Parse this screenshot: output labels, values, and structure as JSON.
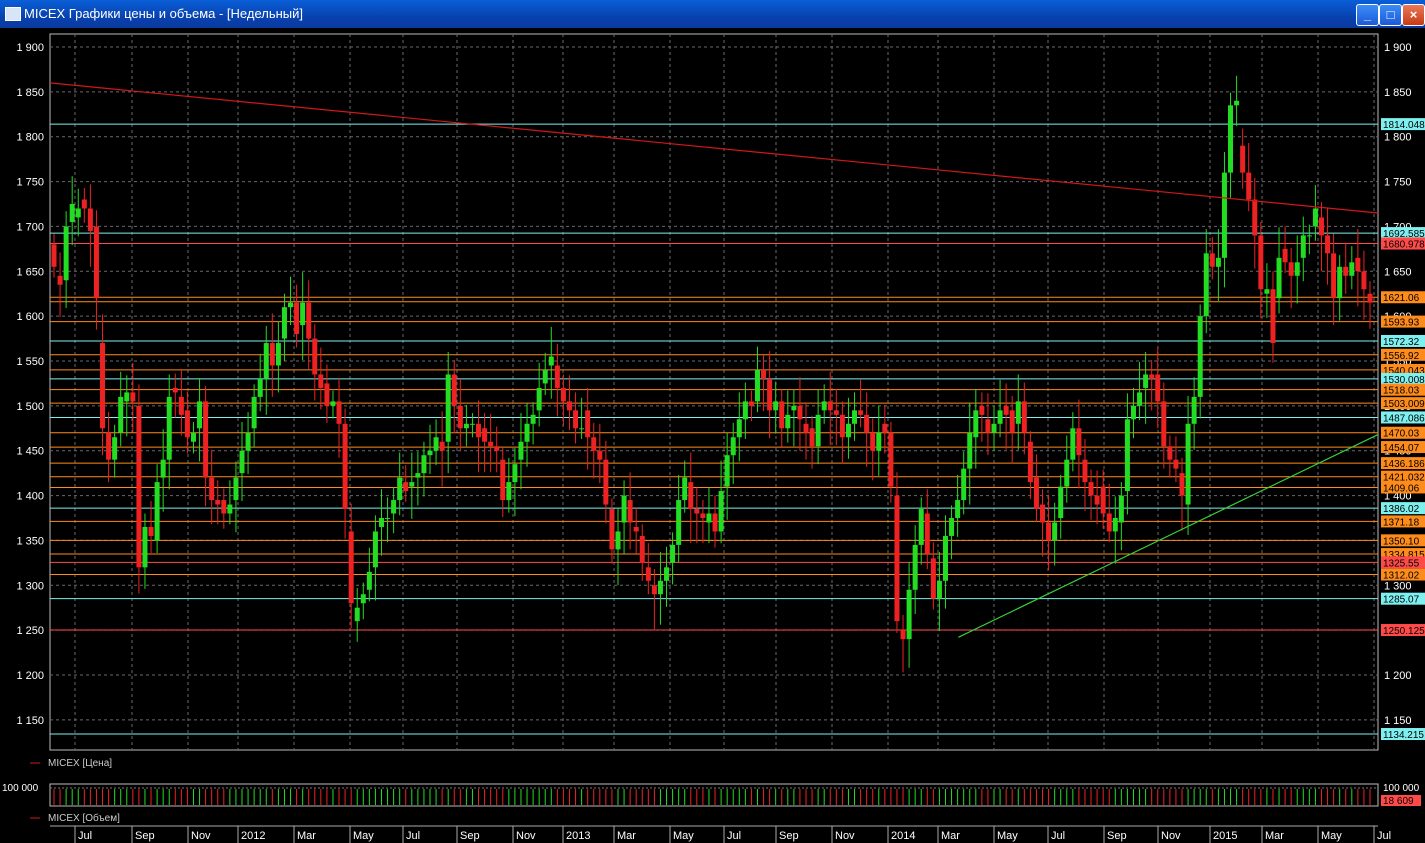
{
  "window": {
    "title": "MICEX Графики цены и объема - [Недельный]",
    "buttons": [
      "_",
      "□",
      "×"
    ]
  },
  "price_panel": {
    "legend": "MICEX [Цена]"
  },
  "volume_panel": {
    "legend": "MICEX [Объем]",
    "left_label": "100 000",
    "right_label": "100 000",
    "last_value": "18 609"
  },
  "colors": {
    "up": "#22dd22",
    "down": "#ee2222",
    "grid": "#6a6a6a",
    "cyan": "#7ff0f0",
    "red": "#ff4a4a",
    "orange": "#ff8c1a",
    "trend_down": "#d01818",
    "trend_up": "#3ad03a"
  },
  "chart_data": {
    "type": "candlestick",
    "title": "MICEX",
    "timeframe": "Недельный",
    "ylim": [
      1130,
      1920
    ],
    "y_ticks": [
      "1 150",
      "1 200",
      "1 250",
      "1 300",
      "1 350",
      "1 400",
      "1 450",
      "1 500",
      "1 550",
      "1 600",
      "1 650",
      "1 700",
      "1 750",
      "1 800",
      "1 850",
      "1 900"
    ],
    "x_labels": [
      "Jul",
      "Sep",
      "Nov",
      "2012",
      "Mar",
      "May",
      "Jul",
      "Sep",
      "Nov",
      "2013",
      "Mar",
      "May",
      "Jul",
      "Sep",
      "Nov",
      "2014",
      "Mar",
      "May",
      "Jul",
      "Sep",
      "Nov",
      "2015",
      "Mar",
      "May",
      "Jul"
    ],
    "candles": [
      [
        1680,
        1655
      ],
      [
        1645,
        1635
      ],
      [
        1640,
        1700
      ],
      [
        1705,
        1725
      ],
      [
        1710,
        1720
      ],
      [
        1730,
        1720
      ],
      [
        1720,
        1695
      ],
      [
        1700,
        1620
      ],
      [
        1570,
        1475
      ],
      [
        1470,
        1440
      ],
      [
        1440,
        1465
      ],
      [
        1470,
        1510
      ],
      [
        1505,
        1515
      ],
      [
        1515,
        1505
      ],
      [
        1500,
        1320
      ],
      [
        1320,
        1365
      ],
      [
        1365,
        1355
      ],
      [
        1350,
        1415
      ],
      [
        1420,
        1440
      ],
      [
        1440,
        1510
      ],
      [
        1520,
        1515
      ],
      [
        1510,
        1490
      ],
      [
        1495,
        1465
      ],
      [
        1460,
        1470
      ],
      [
        1475,
        1505
      ],
      [
        1505,
        1420
      ],
      [
        1420,
        1395
      ],
      [
        1395,
        1390
      ],
      [
        1395,
        1380
      ],
      [
        1380,
        1390
      ],
      [
        1395,
        1420
      ],
      [
        1425,
        1450
      ],
      [
        1450,
        1470
      ],
      [
        1475,
        1510
      ],
      [
        1510,
        1530
      ],
      [
        1530,
        1570
      ],
      [
        1570,
        1545
      ],
      [
        1545,
        1570
      ],
      [
        1575,
        1610
      ],
      [
        1610,
        1615
      ],
      [
        1615,
        1580
      ],
      [
        1590,
        1615
      ],
      [
        1615,
        1575
      ],
      [
        1575,
        1535
      ],
      [
        1535,
        1520
      ],
      [
        1525,
        1500
      ],
      [
        1500,
        1505
      ],
      [
        1505,
        1480
      ],
      [
        1480,
        1385
      ],
      [
        1360,
        1280
      ],
      [
        1260,
        1275
      ],
      [
        1280,
        1290
      ],
      [
        1295,
        1315
      ],
      [
        1320,
        1360
      ],
      [
        1365,
        1375
      ],
      [
        1375,
        1375
      ],
      [
        1380,
        1395
      ],
      [
        1395,
        1420
      ],
      [
        1415,
        1405
      ],
      [
        1410,
        1415
      ],
      [
        1420,
        1425
      ],
      [
        1425,
        1445
      ],
      [
        1445,
        1450
      ],
      [
        1450,
        1465
      ],
      [
        1460,
        1450
      ],
      [
        1460,
        1535
      ],
      [
        1535,
        1500
      ],
      [
        1500,
        1475
      ],
      [
        1475,
        1480
      ],
      [
        1480,
        1480
      ],
      [
        1480,
        1465
      ],
      [
        1475,
        1460
      ],
      [
        1460,
        1455
      ],
      [
        1455,
        1450
      ],
      [
        1440,
        1395
      ],
      [
        1395,
        1415
      ],
      [
        1415,
        1435
      ],
      [
        1440,
        1460
      ],
      [
        1460,
        1480
      ],
      [
        1480,
        1490
      ],
      [
        1495,
        1520
      ],
      [
        1525,
        1540
      ],
      [
        1545,
        1555
      ],
      [
        1545,
        1520
      ],
      [
        1520,
        1505
      ],
      [
        1505,
        1495
      ],
      [
        1495,
        1475
      ],
      [
        1475,
        1475
      ],
      [
        1495,
        1465
      ],
      [
        1465,
        1450
      ],
      [
        1450,
        1440
      ],
      [
        1440,
        1390
      ],
      [
        1385,
        1340
      ],
      [
        1340,
        1360
      ],
      [
        1370,
        1400
      ],
      [
        1395,
        1370
      ],
      [
        1365,
        1360
      ],
      [
        1355,
        1325
      ],
      [
        1320,
        1305
      ],
      [
        1300,
        1290
      ],
      [
        1290,
        1305
      ],
      [
        1305,
        1320
      ],
      [
        1325,
        1345
      ],
      [
        1345,
        1395
      ],
      [
        1395,
        1420
      ],
      [
        1415,
        1385
      ],
      [
        1385,
        1380
      ],
      [
        1380,
        1375
      ],
      [
        1370,
        1380
      ],
      [
        1380,
        1360
      ],
      [
        1360,
        1405
      ],
      [
        1410,
        1445
      ],
      [
        1445,
        1465
      ],
      [
        1465,
        1485
      ],
      [
        1485,
        1505
      ],
      [
        1505,
        1500
      ],
      [
        1505,
        1540
      ],
      [
        1540,
        1530
      ],
      [
        1530,
        1495
      ],
      [
        1495,
        1505
      ],
      [
        1505,
        1475
      ],
      [
        1475,
        1490
      ],
      [
        1495,
        1500
      ],
      [
        1500,
        1485
      ],
      [
        1480,
        1470
      ],
      [
        1475,
        1455
      ],
      [
        1455,
        1490
      ],
      [
        1495,
        1505
      ],
      [
        1505,
        1495
      ],
      [
        1495,
        1490
      ],
      [
        1490,
        1465
      ],
      [
        1465,
        1480
      ],
      [
        1480,
        1495
      ],
      [
        1495,
        1490
      ],
      [
        1490,
        1470
      ],
      [
        1470,
        1450
      ],
      [
        1450,
        1470
      ],
      [
        1480,
        1470
      ],
      [
        1470,
        1410
      ],
      [
        1400,
        1260
      ],
      [
        1250,
        1240
      ],
      [
        1240,
        1295
      ],
      [
        1295,
        1345
      ],
      [
        1345,
        1385
      ],
      [
        1380,
        1335
      ],
      [
        1330,
        1285
      ],
      [
        1285,
        1305
      ],
      [
        1305,
        1355
      ],
      [
        1355,
        1375
      ],
      [
        1375,
        1395
      ],
      [
        1395,
        1430
      ],
      [
        1430,
        1470
      ],
      [
        1465,
        1495
      ],
      [
        1500,
        1490
      ],
      [
        1485,
        1470
      ],
      [
        1470,
        1480
      ],
      [
        1480,
        1495
      ],
      [
        1500,
        1490
      ],
      [
        1495,
        1470
      ],
      [
        1480,
        1505
      ],
      [
        1505,
        1470
      ],
      [
        1460,
        1415
      ],
      [
        1420,
        1385
      ],
      [
        1390,
        1370
      ],
      [
        1370,
        1350
      ],
      [
        1350,
        1370
      ],
      [
        1375,
        1410
      ],
      [
        1410,
        1440
      ],
      [
        1440,
        1475
      ],
      [
        1475,
        1445
      ],
      [
        1440,
        1415
      ],
      [
        1415,
        1400
      ],
      [
        1400,
        1390
      ],
      [
        1410,
        1380
      ],
      [
        1380,
        1360
      ],
      [
        1360,
        1375
      ],
      [
        1370,
        1400
      ],
      [
        1405,
        1485
      ],
      [
        1485,
        1500
      ],
      [
        1500,
        1515
      ],
      [
        1520,
        1535
      ],
      [
        1535,
        1530
      ],
      [
        1535,
        1505
      ],
      [
        1505,
        1455
      ],
      [
        1455,
        1440
      ],
      [
        1440,
        1430
      ],
      [
        1425,
        1400
      ],
      [
        1390,
        1480
      ],
      [
        1480,
        1510
      ],
      [
        1510,
        1600
      ],
      [
        1600,
        1670
      ],
      [
        1670,
        1655
      ],
      [
        1655,
        1665
      ],
      [
        1665,
        1760
      ],
      [
        1760,
        1835
      ],
      [
        1835,
        1840
      ],
      [
        1790,
        1760
      ],
      [
        1760,
        1730
      ],
      [
        1730,
        1690
      ],
      [
        1690,
        1630
      ],
      [
        1625,
        1630
      ],
      [
        1630,
        1570
      ],
      [
        1620,
        1665
      ],
      [
        1675,
        1660
      ],
      [
        1660,
        1645
      ],
      [
        1645,
        1660
      ],
      [
        1665,
        1690
      ],
      [
        1690,
        1690
      ],
      [
        1700,
        1720
      ],
      [
        1710,
        1690
      ],
      [
        1690,
        1670
      ],
      [
        1670,
        1620
      ],
      [
        1620,
        1655
      ],
      [
        1655,
        1645
      ],
      [
        1645,
        1660
      ],
      [
        1665,
        1650
      ],
      [
        1650,
        1630
      ],
      [
        1625,
        1615
      ]
    ],
    "trendlines": [
      {
        "name": "resistance",
        "from": [
          0,
          1860
        ],
        "to": [
          1.0,
          1715
        ]
      },
      {
        "name": "support",
        "from": [
          0.684,
          1242
        ],
        "to": [
          1.0,
          1468
        ]
      }
    ],
    "levels": [
      {
        "value": 1814.048,
        "label": "1814.048",
        "color": "cyan"
      },
      {
        "value": 1692.585,
        "label": "1692.585",
        "color": "cyan"
      },
      {
        "value": 1680.978,
        "label": "1680.978",
        "color": "red"
      },
      {
        "value": 1621.06,
        "label": "1621.06",
        "color": "orange"
      },
      {
        "value": 1616.0,
        "label": "",
        "color": "orange"
      },
      {
        "value": 1593.93,
        "label": "1593.93",
        "color": "orange"
      },
      {
        "value": 1572.32,
        "label": "1572.32",
        "color": "cyan"
      },
      {
        "value": 1556.92,
        "label": "1556.92",
        "color": "orange"
      },
      {
        "value": 1540.043,
        "label": "1540.043",
        "color": "orange"
      },
      {
        "value": 1530.008,
        "label": "1530.008",
        "color": "cyan"
      },
      {
        "value": 1518.03,
        "label": "1518.03",
        "color": "orange"
      },
      {
        "value": 1503.009,
        "label": "1503.009",
        "color": "orange"
      },
      {
        "value": 1487.086,
        "label": "1487.086",
        "color": "cyan"
      },
      {
        "value": 1470.03,
        "label": "1470.03",
        "color": "orange"
      },
      {
        "value": 1454.07,
        "label": "1454.07",
        "color": "orange"
      },
      {
        "value": 1436.186,
        "label": "1436.186",
        "color": "orange"
      },
      {
        "value": 1421.032,
        "label": "1421.032",
        "color": "orange"
      },
      {
        "value": 1409.06,
        "label": "1409.06",
        "color": "orange"
      },
      {
        "value": 1386.02,
        "label": "1386.02",
        "color": "cyan"
      },
      {
        "value": 1371.18,
        "label": "1371.18",
        "color": "orange"
      },
      {
        "value": 1350.1,
        "label": "1350.10",
        "color": "orange"
      },
      {
        "value": 1334.815,
        "label": "1334.815",
        "color": "orange"
      },
      {
        "value": 1325.55,
        "label": "1325.55",
        "color": "red"
      },
      {
        "value": 1312.02,
        "label": "1312.02",
        "color": "orange"
      },
      {
        "value": 1285.07,
        "label": "1285.07",
        "color": "cyan"
      },
      {
        "value": 1250.125,
        "label": "1250.125",
        "color": "red"
      },
      {
        "value": 1134.215,
        "label": "1134.215",
        "color": "cyan"
      }
    ]
  }
}
